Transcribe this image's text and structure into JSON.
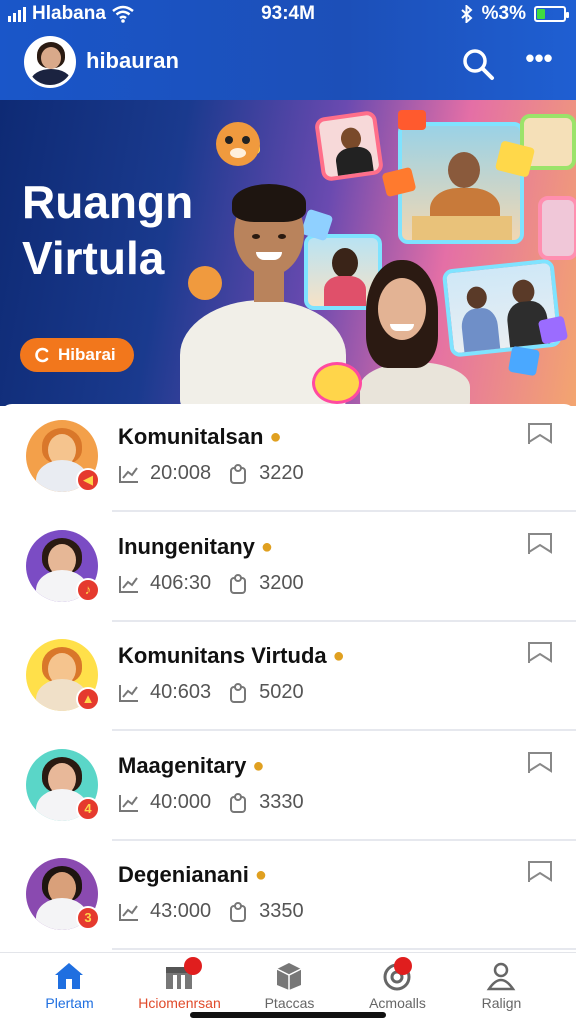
{
  "status_bar": {
    "carrier": "Hlabana",
    "time": "93:4M",
    "battery": "%3%",
    "battery_level": 0.3
  },
  "app_bar": {
    "title": "hibauran",
    "icons": [
      "search-icon",
      "more-icon"
    ]
  },
  "banner": {
    "headline_line1": "Ruangn",
    "headline_line2": "Virtula",
    "cta_label": "Hibarai",
    "cta_color": "#f2771c"
  },
  "communities": [
    {
      "name": "Komunitalsan",
      "views": "20:008",
      "members": "3220",
      "badge": "◀",
      "avatar": "fox-mascot"
    },
    {
      "name": "lnungenitany",
      "views": "406:30",
      "members": "3200",
      "badge": "♪",
      "avatar": "woman"
    },
    {
      "name": "Komunitans Virtuda",
      "views": "40:603",
      "members": "5020",
      "badge": "▲",
      "avatar": "fox-mascot"
    },
    {
      "name": "Maagenitary",
      "views": "40:000",
      "members": "3330",
      "badge": "4",
      "avatar": "woman"
    },
    {
      "name": "Degenianani",
      "views": "43:000",
      "members": "3350",
      "badge": "3",
      "avatar": "man"
    }
  ],
  "bottom_nav": [
    {
      "label": "Plertam",
      "icon": "home-icon",
      "state": "active"
    },
    {
      "label": "Hciomenrsan",
      "icon": "store-icon",
      "state": "notification"
    },
    {
      "label": "Ptaccas",
      "icon": "box-icon",
      "state": "normal"
    },
    {
      "label": "Acmoalls",
      "icon": "target-icon",
      "state": "notification"
    },
    {
      "label": "Ralign",
      "icon": "profile-icon",
      "state": "normal"
    }
  ],
  "colors": {
    "header": "#1c4fb8",
    "accent": "#1f6fe0",
    "badge": "#e53a2e"
  }
}
